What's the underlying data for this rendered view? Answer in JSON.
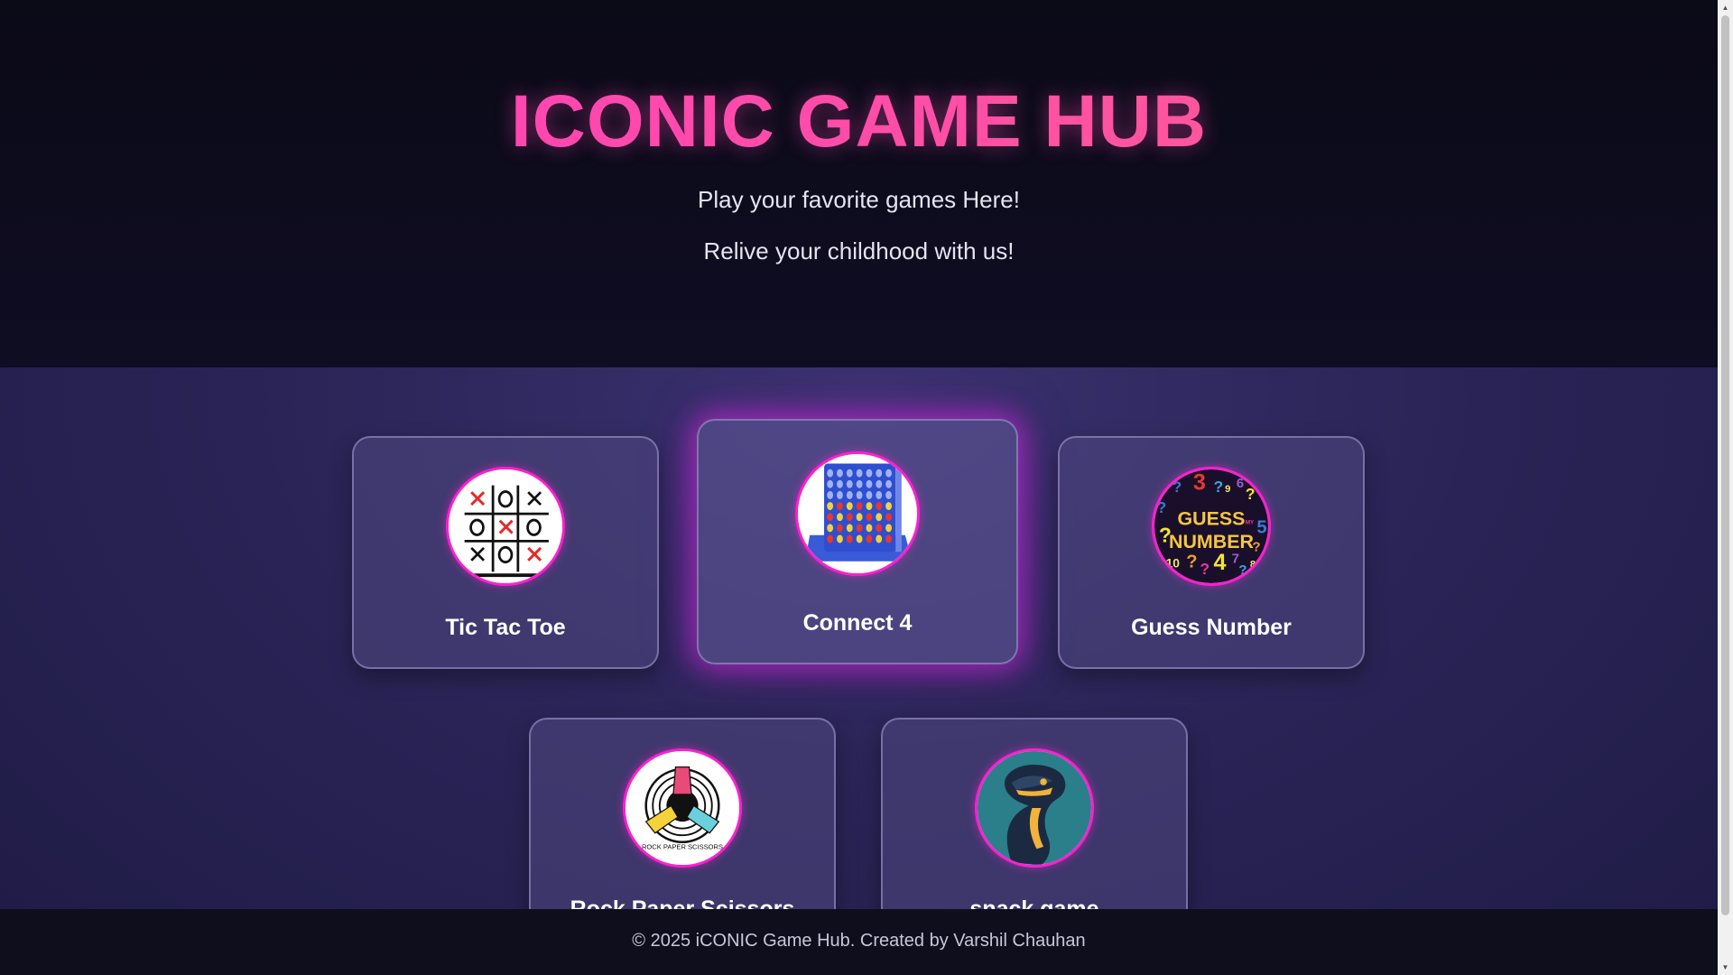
{
  "header": {
    "title": "ICONIC GAME HUB",
    "subtitle_1": "Play your favorite games Here!",
    "subtitle_2": "Relive your childhood with us!"
  },
  "games": [
    {
      "label": "Tic Tac Toe",
      "icon": "tic-tac-toe-icon"
    },
    {
      "label": "Connect 4",
      "icon": "connect-four-icon",
      "state": "hovered"
    },
    {
      "label": "Guess Number",
      "icon": "guess-number-icon",
      "icon_text": [
        "GUESS",
        "MY",
        "NUMBER"
      ]
    },
    {
      "label": "Rock Paper Scissors",
      "icon": "rock-paper-scissors-icon",
      "icon_text": "ROCK PAPER SCISSORS"
    },
    {
      "label": "snack game",
      "icon": "snake-icon"
    }
  ],
  "footer": {
    "text": "© 2025 iCONIC Game Hub. Created by Varshil Chauhan"
  },
  "colors": {
    "title_gradient_start": "#ff3fbf",
    "title_gradient_end": "#ff6a88",
    "accent_border": "#ff1fd0",
    "header_bg": "#0b0a17",
    "footer_bg": "#0f0e1c"
  }
}
